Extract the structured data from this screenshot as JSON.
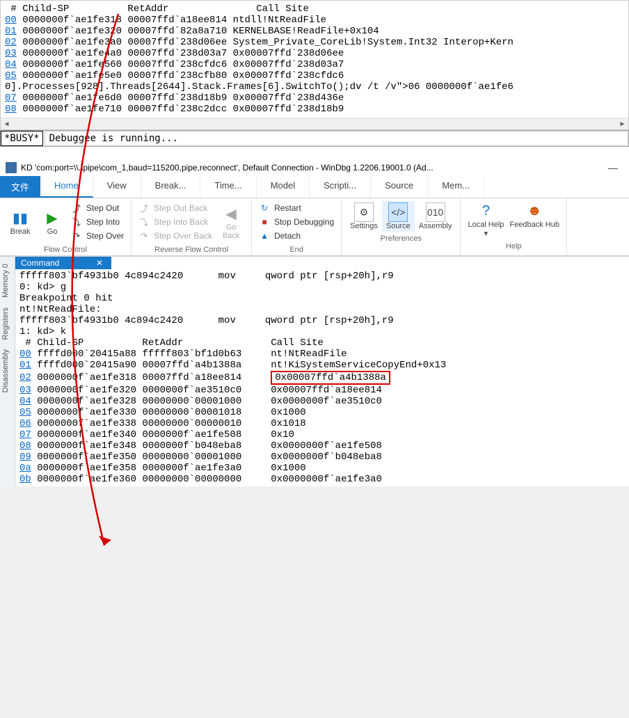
{
  "top": {
    "header": " # Child-SP          RetAddr               Call Site",
    "rows": [
      {
        "n": "00",
        "sp": "0000000f`ae1fe318",
        "ret": "00007ffd`a18ee814",
        "site": "ntdll!NtReadFile"
      },
      {
        "n": "01",
        "sp": "0000000f`ae1fe320",
        "ret": "00007ffd`82a8a710",
        "site": "KERNELBASE!ReadFile+0x104"
      },
      {
        "n": "02",
        "sp": "0000000f`ae1fe3a0",
        "ret": "00007ffd`238d06ee",
        "site": "System_Private_CoreLib!System.Int32 Interop+Kern"
      },
      {
        "n": "03",
        "sp": "0000000f`ae1fe4a0",
        "ret": "00007ffd`238d03a7",
        "site": "0x00007ffd`238d06ee"
      },
      {
        "n": "04",
        "sp": "0000000f`ae1fe560",
        "ret": "00007ffd`238cfdc6",
        "site": "0x00007ffd`238d03a7"
      },
      {
        "n": "05",
        "sp": "0000000f`ae1fe5e0",
        "ret": "00007ffd`238cfb80",
        "site": "0x00007ffd`238cfdc6"
      }
    ],
    "inline": "0].Processes[928].Threads[2644].Stack.Frames[6].SwitchTo();dv /t /v\">06 0000000f`ae1fe6",
    "rows2": [
      {
        "n": "07",
        "sp": "0000000f`ae1fe6d0",
        "ret": "00007ffd`238d18b9",
        "site": "0x00007ffd`238d436e"
      },
      {
        "n": "08",
        "sp": "0000000f`ae1fe710",
        "ret": "00007ffd`238c2dcc",
        "site": "0x00007ffd`238d18b9"
      }
    ]
  },
  "status": {
    "busy": "*BUSY*",
    "text": "Debuggee is running..."
  },
  "titlebar": {
    "title": "KD 'com:port=\\\\.\\pipe\\com_1,baud=115200,pipe,reconnect', Default Connection  -  WinDbg 1.2206.19001.0 (Ad..."
  },
  "tabs": {
    "file": "文件",
    "items": [
      "Home",
      "View",
      "Break...",
      "Time...",
      "Model",
      "Scripti...",
      "Source",
      "Mem..."
    ],
    "active": 0
  },
  "ribbon": {
    "break": "Break",
    "go": "Go",
    "stepout": "Step Out",
    "stepinto": "Step Into",
    "stepover": "Step Over",
    "flow_label": "Flow Control",
    "stepoutback": "Step Out Back",
    "stepintoback": "Step Into Back",
    "stepoverback": "Step Over Back",
    "goback": "Go Back",
    "rev_label": "Reverse Flow Control",
    "restart": "Restart",
    "stopdbg": "Stop Debugging",
    "detach": "Detach",
    "end_label": "End",
    "settings": "Settings",
    "source": "Source",
    "assembly": "Assembly",
    "pref_label": "Preferences",
    "localhelp": "Local Help",
    "localhelp_sub": "▾",
    "feedback": "Feedback Hub",
    "help_label": "Help"
  },
  "side": [
    "Memory 0",
    "Registers",
    "Disassembly"
  ],
  "cmd": {
    "title": "Command",
    "lines_pre": [
      "fffff803`bf4931b0 4c894c2420      mov     qword ptr [rsp+20h],r9",
      "0: kd> g",
      "Breakpoint 0 hit",
      "nt!NtReadFile:",
      "fffff803`bf4931b0 4c894c2420      mov     qword ptr [rsp+20h],r9",
      "1: kd> k",
      " # Child-SP          RetAddr               Call Site"
    ],
    "frames": [
      {
        "n": "00",
        "sp": "ffffd000`20415a88",
        "ret": "fffff803`bf1d0b63",
        "site": "nt!NtReadFile",
        "hl": false
      },
      {
        "n": "01",
        "sp": "ffffd000`20415a90",
        "ret": "00007ffd`a4b1388a",
        "site": "nt!KiSystemServiceCopyEnd+0x13",
        "hl": false
      },
      {
        "n": "02",
        "sp": "0000000f`ae1fe318",
        "ret": "00007ffd`a18ee814",
        "site": "0x00007ffd`a4b1388a",
        "hl": true
      },
      {
        "n": "03",
        "sp": "0000000f`ae1fe320",
        "ret": "0000000f`ae3510c0",
        "site": "0x00007ffd`a18ee814",
        "hl": false
      },
      {
        "n": "04",
        "sp": "0000000f`ae1fe328",
        "ret": "00000000`00001000",
        "site": "0x0000000f`ae3510c0",
        "hl": false
      },
      {
        "n": "05",
        "sp": "0000000f`ae1fe330",
        "ret": "00000000`00001018",
        "site": "0x1000",
        "hl": false
      },
      {
        "n": "06",
        "sp": "0000000f`ae1fe338",
        "ret": "00000000`00000010",
        "site": "0x1018",
        "hl": false
      },
      {
        "n": "07",
        "sp": "0000000f`ae1fe340",
        "ret": "0000000f`ae1fe508",
        "site": "0x10",
        "hl": false
      },
      {
        "n": "08",
        "sp": "0000000f`ae1fe348",
        "ret": "0000000f`b048eba8",
        "site": "0x0000000f`ae1fe508",
        "hl": false
      },
      {
        "n": "09",
        "sp": "0000000f`ae1fe350",
        "ret": "00000000`00001000",
        "site": "0x0000000f`b048eba8",
        "hl": false
      },
      {
        "n": "0a",
        "sp": "0000000f`ae1fe358",
        "ret": "0000000f`ae1fe3a0",
        "site": "0x1000",
        "hl": false
      },
      {
        "n": "0b",
        "sp": "0000000f`ae1fe360",
        "ret": "00000000`00000000",
        "site": "0x0000000f`ae1fe3a0",
        "hl": false
      }
    ]
  }
}
